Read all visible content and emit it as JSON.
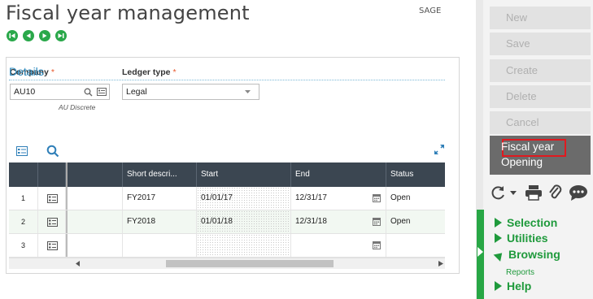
{
  "header": {
    "title": "Fiscal year management",
    "folder": "SAGE"
  },
  "nav": [
    "first-record",
    "previous-record",
    "next-record",
    "last-record"
  ],
  "form": {
    "company": {
      "label": "Company",
      "value": "AU10",
      "description": "AU Discrete"
    },
    "ledger_type": {
      "label": "Ledger type",
      "value": "Legal"
    }
  },
  "details": {
    "title": "Details",
    "columns": [
      "Short descri...",
      "Start",
      "End",
      "Status"
    ],
    "rows": [
      {
        "num": "1",
        "short": "FY2017",
        "start": "01/01/17",
        "end": "12/31/17",
        "status": "Open"
      },
      {
        "num": "2",
        "short": "FY2018",
        "start": "01/01/18",
        "end": "12/31/18",
        "status": "Open"
      },
      {
        "num": "3",
        "short": "",
        "start": "",
        "end": "",
        "status": ""
      }
    ]
  },
  "actions": {
    "new": "New",
    "save": "Save",
    "create": "Create",
    "delete": "Delete",
    "cancel": "Cancel",
    "fiscal_year_opening_line1": "Fiscal year",
    "fiscal_year_opening_line2": "Opening"
  },
  "sidebar_menu": {
    "selection": "Selection",
    "utilities": "Utilities",
    "browsing": "Browsing",
    "reports": "Reports",
    "help": "Help"
  },
  "colors": {
    "accent_green": "#28a745",
    "header_dark": "#3b4651",
    "required": "#e8562a",
    "highlight_red": "#e0191f"
  }
}
